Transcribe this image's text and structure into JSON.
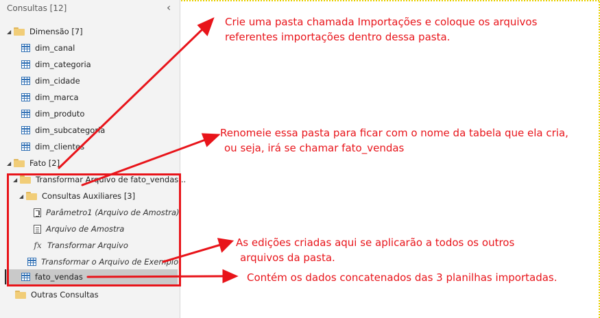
{
  "pane": {
    "header": "Consultas [12]",
    "collapse_icon": "chevron-left-icon",
    "tree": {
      "dimensao": {
        "label": "Dimensão [7]",
        "items": [
          "dim_canal",
          "dim_categoria",
          "dim_cidade",
          "dim_marca",
          "dim_produto",
          "dim_subcategoria",
          "dim_clientes"
        ]
      },
      "fato": {
        "label": "Fato [2]",
        "transformar_folder": "Transformar Arquivo de fato_vendas...",
        "auxiliares_folder": "Consultas Auxiliares [3]",
        "auxiliares_items": [
          "Parâmetro1 (Arquivo de Amostra)",
          "Arquivo de Amostra",
          "Transformar Arquivo"
        ],
        "transformar_exemplo": "Transformar o Arquivo de Exemplo",
        "fato_vendas": "fato_vendas"
      },
      "outras": {
        "label": "Outras Consultas"
      }
    }
  },
  "annotations": {
    "note1_line1": "Crie uma pasta chamada Importações e coloque os arquivos",
    "note1_line2": "referentes importações dentro dessa pasta.",
    "note2_line1": "Renomeie essa pasta para ficar com o nome da tabela que ela cria,",
    "note2_line2": "ou seja, irá se chamar fato_vendas",
    "note3_line1": "As edições criadas aqui se aplicarão a todos os outros",
    "note3_line2": "arquivos da pasta.",
    "note4_line1": "Contém os dados concatenados das 3 planilhas importadas."
  },
  "colors": {
    "annotation": "#e8141a",
    "frame": "#e8d000",
    "pane_bg": "#f3f3f3",
    "selected_row": "#c9c9c9"
  }
}
